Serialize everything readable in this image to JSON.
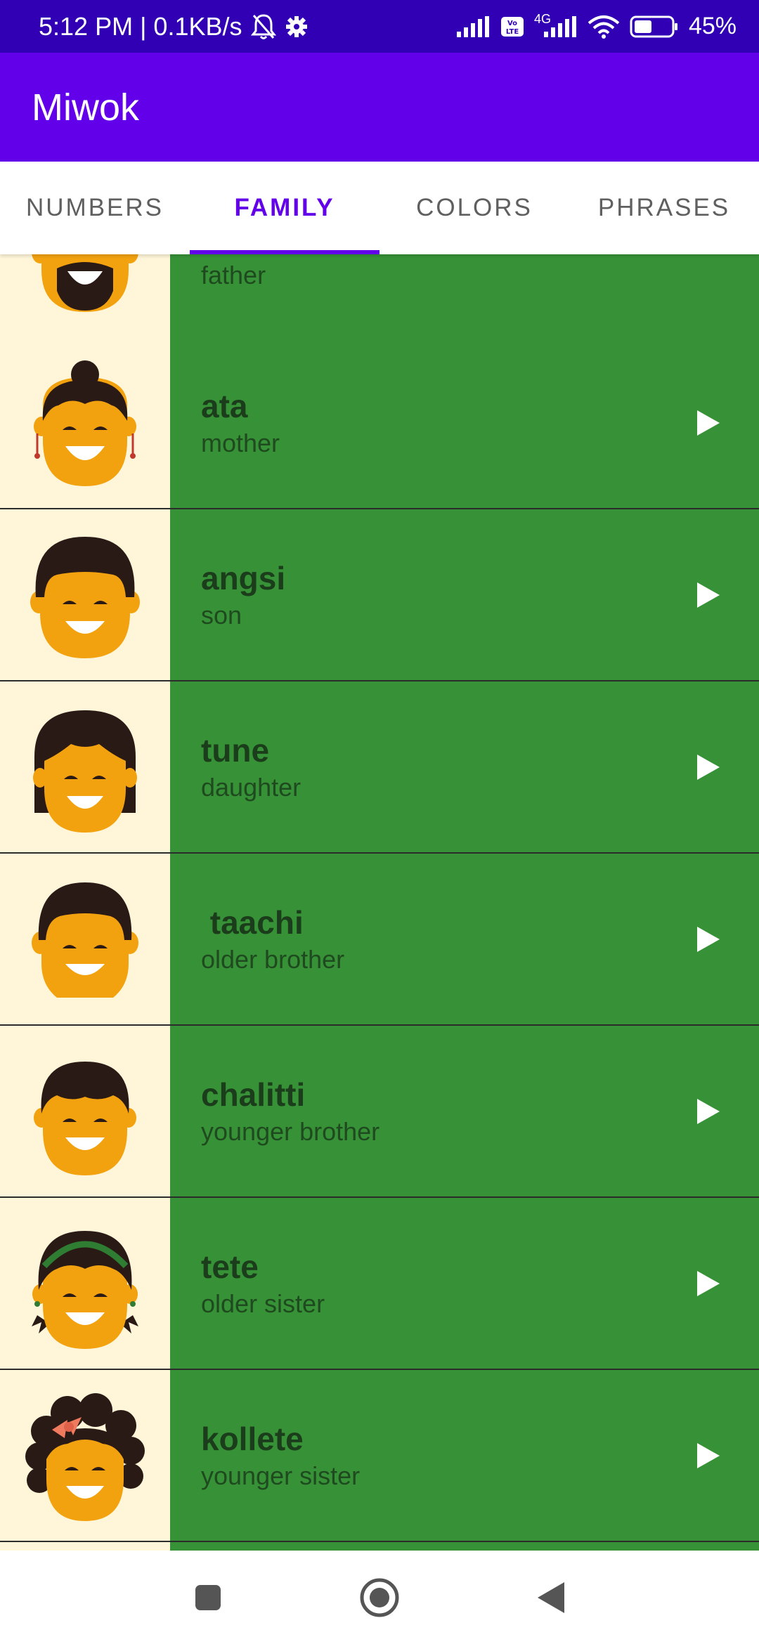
{
  "status_bar": {
    "time_speed": "5:12 PM | 0.1KB/s",
    "network": "4G",
    "battery": "45%",
    "icons": [
      "bell-off-icon",
      "gear-icon",
      "signal-icon",
      "volte-icon",
      "signal-4g-icon",
      "wifi-icon",
      "battery-icon"
    ]
  },
  "app_bar": {
    "title": "Miwok"
  },
  "tabs": [
    {
      "label": "NUMBERS",
      "active": false
    },
    {
      "label": "FAMILY",
      "active": true
    },
    {
      "label": "COLORS",
      "active": false
    },
    {
      "label": "PHRASES",
      "active": false
    }
  ],
  "words": [
    {
      "miwok": "",
      "english": "father",
      "avatar": "father-avatar"
    },
    {
      "miwok": "ata",
      "english": "mother",
      "avatar": "mother-avatar"
    },
    {
      "miwok": "angsi",
      "english": "son",
      "avatar": "son-avatar"
    },
    {
      "miwok": "tune",
      "english": "daughter",
      "avatar": "daughter-avatar"
    },
    {
      "miwok": " taachi",
      "english": "older brother",
      "avatar": "older-brother-avatar"
    },
    {
      "miwok": "chalitti",
      "english": "younger brother",
      "avatar": "younger-brother-avatar"
    },
    {
      "miwok": "tete",
      "english": "older sister",
      "avatar": "older-sister-avatar"
    },
    {
      "miwok": "kollete",
      "english": "younger sister",
      "avatar": "younger-sister-avatar"
    }
  ],
  "colors": {
    "status_bar": "#3200b4",
    "primary": "#6200ea",
    "category_family": "#379237",
    "image_background": "#fff6d9",
    "skin": "#f3a20f",
    "hair": "#2a1a16"
  },
  "nav_bar": {
    "icons": [
      "recent-apps-icon",
      "home-icon",
      "back-icon"
    ]
  }
}
